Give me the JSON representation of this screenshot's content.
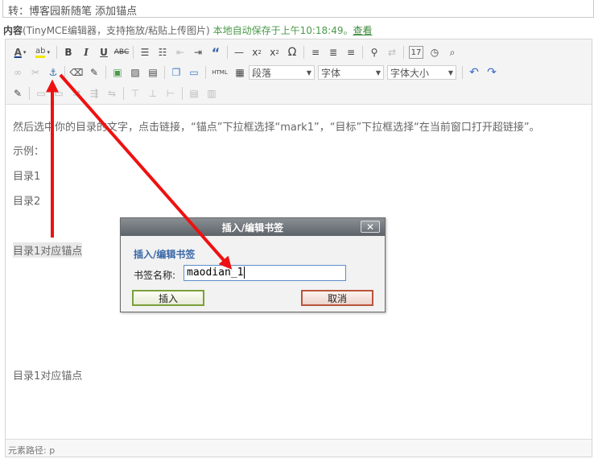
{
  "title_field": {
    "value": "转：博客园新随笔 添加锚点"
  },
  "content_label": {
    "prefix": "内容",
    "desc": "(TinyMCE编辑器，支持拖放/粘贴上传图片)",
    "autosave": "本地自动保存于上午10:18:49。",
    "view_link": "查看"
  },
  "toolbar": {
    "html_label": "HTML",
    "format_select": "段落",
    "font_select": "字体",
    "size_select": "字体大小"
  },
  "body": {
    "instruction": "然后选中你的目录的文字，点击链接，“锚点”下拉框选择“mark1”，“目标”下拉框选择“在当前窗口打开超链接”。",
    "example": "示例：",
    "toc1": "目录1",
    "toc2": "目录2",
    "anchor1": "目录1对应锚点",
    "anchor2": "目录1对应锚点"
  },
  "status_bar": {
    "path": "元素路径: p"
  },
  "dialog": {
    "title": "插入/编辑书签",
    "close_label": "✕",
    "heading": "插入/编辑书签",
    "field_label": "书签名称:",
    "field_value": "maodian_1",
    "insert_label": "插入",
    "cancel_label": "取消"
  },
  "colors": {
    "arrow": "#ee1111",
    "dialog_heading": "#3a68a8",
    "autosave": "#4a9a4a"
  },
  "icons": [
    "font-color-icon",
    "highlight-color-icon",
    "bold-icon",
    "italic-icon",
    "underline-icon",
    "strikethrough-icon",
    "unordered-list-icon",
    "ordered-list-icon",
    "outdent-icon",
    "indent-icon",
    "blockquote-icon",
    "horizontal-rule-icon",
    "subscript-icon",
    "superscript-icon",
    "omega-icon",
    "align-left-icon",
    "align-center-icon",
    "align-right-icon",
    "find-icon",
    "replace-icon",
    "date-icon",
    "time-icon",
    "preview-icon",
    "link-icon",
    "unlink-icon",
    "anchor-icon",
    "eraser-icon",
    "cleanup-icon",
    "image-upload-icon",
    "image-icon",
    "media-icon",
    "copy-icon",
    "paste-icon",
    "html-icon",
    "fullscreen-icon",
    "undo-icon",
    "redo-icon",
    "edit-icon"
  ]
}
